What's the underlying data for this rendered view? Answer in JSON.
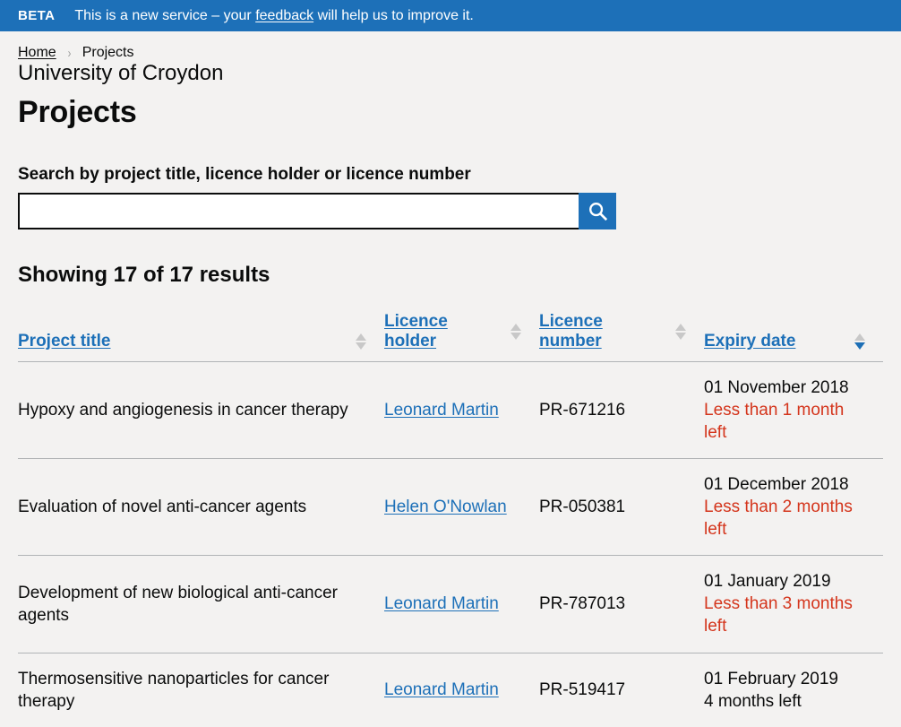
{
  "phase_banner": {
    "tag": "BETA",
    "text_before": "This is a new service – your ",
    "link_label": "feedback",
    "text_after": " will help us to improve it."
  },
  "breadcrumbs": {
    "home_label": "Home",
    "separator": "›",
    "current_label": "Projects"
  },
  "header": {
    "caption": "University of Croydon",
    "title": "Projects"
  },
  "search": {
    "label": "Search by project title, licence holder or licence number",
    "value": "",
    "placeholder": "",
    "button_icon": "search-icon"
  },
  "results": {
    "summary": "Showing 17 of 17 results"
  },
  "table": {
    "columns": [
      {
        "label": "Project title",
        "sort": "none"
      },
      {
        "label": "Licence holder",
        "sort": "none"
      },
      {
        "label": "Licence number",
        "sort": "none"
      },
      {
        "label": "Expiry date",
        "sort": "descending"
      }
    ],
    "rows": [
      {
        "title": "Hypoxy and angiogenesis in cancer therapy",
        "holder": "Leonard Martin",
        "number": "PR-671216",
        "expiry_date": "01 November 2018",
        "expiry_note": "Less than 1 month left",
        "expiry_warning": true
      },
      {
        "title": "Evaluation of novel anti-cancer agents",
        "holder": "Helen O'Nowlan",
        "number": "PR-050381",
        "expiry_date": "01 December 2018",
        "expiry_note": "Less than 2 months left",
        "expiry_warning": true
      },
      {
        "title": "Development of new biological anti-cancer agents",
        "holder": "Leonard Martin",
        "number": "PR-787013",
        "expiry_date": "01 January 2019",
        "expiry_note": "Less than 3 months left",
        "expiry_warning": true
      },
      {
        "title": "Thermosensitive nanoparticles for cancer therapy",
        "holder": "Leonard Martin",
        "number": "PR-519417",
        "expiry_date": "01 February 2019",
        "expiry_note": "4 months left",
        "expiry_warning": false
      }
    ]
  },
  "colors": {
    "brand_blue": "#1d70b8",
    "link_blue": "#1d70b8",
    "warning_red": "#d4351c",
    "page_background": "#f3f2f1",
    "text": "#0b0c0c",
    "border_grey": "#b1b4b6",
    "arrow_grey": "#c8c8c8"
  }
}
